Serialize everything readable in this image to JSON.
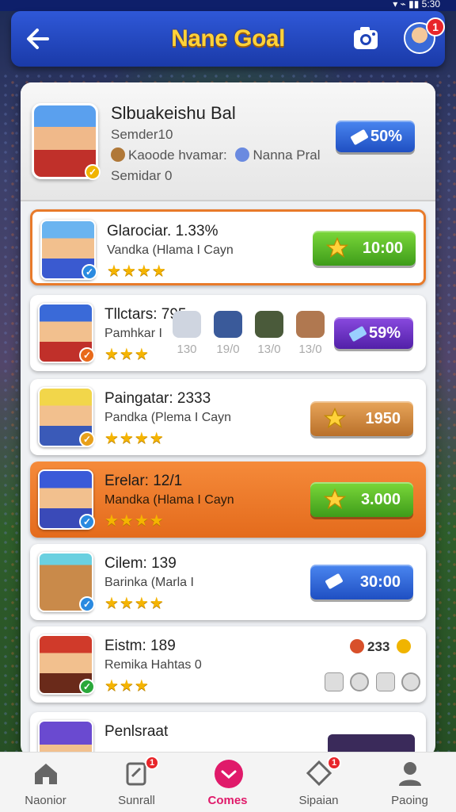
{
  "header": {
    "title": "Nane Goal",
    "notification_count": "1"
  },
  "profile": {
    "name": "Slbuakeishu Bal",
    "line1": "Semder10",
    "line2_a": "Kaoode hvamar:",
    "line2_b": "Nanna Pral",
    "line3": "Semidar 0",
    "button": "50%"
  },
  "cards": [
    {
      "title": "Glarociar. 1.33%",
      "sub": "Vandka (Hlama I Cayn",
      "stars": "★★★★",
      "button": "10:00"
    },
    {
      "title": "Tllctars: 795",
      "sub": "Pamhkar I",
      "stars": "★★★",
      "items": [
        "130",
        "19/0",
        "13/0",
        "13/0"
      ],
      "button": "59%"
    },
    {
      "title": "Paingatar: 2333",
      "sub": "Pandka (Plema I Cayn",
      "stars": "★★★★",
      "button": "1950"
    },
    {
      "title": "Erelar: 12/1",
      "sub": "Mandka (Hlama I Cayn",
      "stars": "★★★★",
      "button": "3.000"
    },
    {
      "title": "Cilem: 139",
      "sub": "Barinka (Marla I",
      "stars": "★★★★",
      "button": "30:00"
    },
    {
      "title": "Eistm: 189",
      "sub": "Remika Hahtas 0",
      "stars": "★★★",
      "count": "233"
    },
    {
      "title": "Penlsraat"
    }
  ],
  "nav": [
    {
      "label": "Naonior"
    },
    {
      "label": "Sunrall",
      "badge": "1"
    },
    {
      "label": "Comes"
    },
    {
      "label": "Sipaian",
      "badge": "1"
    },
    {
      "label": "Paoing"
    }
  ]
}
